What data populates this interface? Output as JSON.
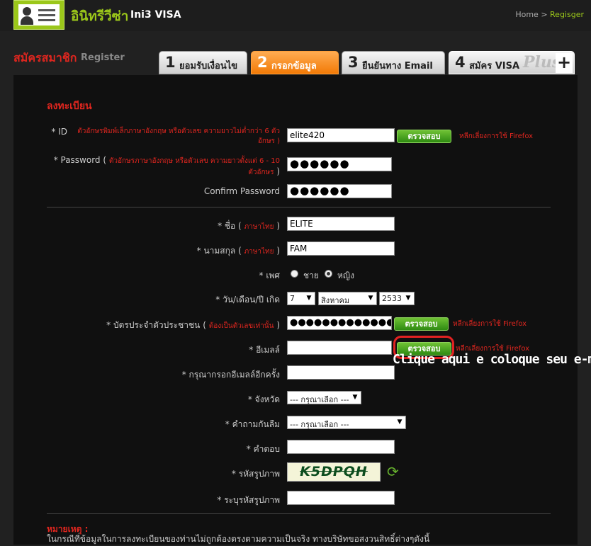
{
  "header": {
    "brand_thai": "อินิทรีวีซ่า",
    "brand_en": "Ini3 VISA",
    "nav_home": "Home",
    "nav_sep": ">",
    "nav_current": "Regisger"
  },
  "page": {
    "title_thai": "สมัครสมาชิก",
    "title_en": "Register"
  },
  "steps": [
    {
      "num": "1",
      "label": "ยอมรับเงื่อนไข",
      "state": "done"
    },
    {
      "num": "2",
      "label": "กรอกข้อมูล",
      "state": "active"
    },
    {
      "num": "3",
      "label": "ยืนยันทาง Email",
      "state": "pending"
    },
    {
      "num": "4",
      "label": "สมัคร VISA",
      "extra": "Plus!",
      "state": "pending"
    }
  ],
  "form": {
    "section_title": "ลงทะเบียน",
    "id": {
      "label": "* ID",
      "hint": "ตัวอักษรพิมพ์เล็กภาษาอังกฤษ หรือตัวเลข ความยาวไม่ต่ำกว่า 6 ตัวอักษร )",
      "value": "elite420",
      "check_label": "ตรวจสอบ",
      "browser_note": "หลีกเลี่ยงการใช้ Firefox"
    },
    "password": {
      "label": "* Password (",
      "hint": "ตัวอักษรภาษาอังกฤษ หรือตัวเลข ความยาวตั้งแต่ 6 - 10 ตัวอักษร",
      "hint_close": ")",
      "value": "●●●●●●"
    },
    "confirm_password": {
      "label": "Confirm Password",
      "value": "●●●●●●"
    },
    "first_name": {
      "label": "* ชื่อ (",
      "note": "ภาษาไทย",
      "close": ")",
      "value": "ELITE"
    },
    "last_name": {
      "label": "* นามสกุล (",
      "note": "ภาษาไทย",
      "close": ")",
      "value": "FAM"
    },
    "gender": {
      "label": "* เพศ",
      "options": [
        "ชาย",
        "หญิง"
      ],
      "selected": "หญิง"
    },
    "birthdate": {
      "label": "* วัน/เดือน/ปี เกิด",
      "day": "7",
      "month": "สิงหาคม",
      "year": "2533"
    },
    "citizen_id": {
      "label": "* บัตรประจำตัวประชาชน (",
      "note": "ต้องเป็นตัวเลขเท่านั้น",
      "close": ")",
      "value": "●●●●●●●●●●●●●",
      "check_label": "ตรวจสอบ",
      "browser_note": "หลีกเลี่ยงการใช้ Firefox"
    },
    "email": {
      "label": "* อีเมลล์",
      "value": "",
      "check_label": "ตรวจสอบ",
      "browser_note": "หลีกเลี่ยงการใช้ Firefox"
    },
    "email_confirm": {
      "label": "* กรุณากรอกอีเมลล์อีกครั้ง",
      "value": ""
    },
    "province": {
      "label": "* จังหวัด",
      "value": "--- กรุณาเลือก ---"
    },
    "security_question": {
      "label": "* คำถามกันลืม",
      "value": "--- กรุณาเลือก ---"
    },
    "answer": {
      "label": "* คำตอบ",
      "value": ""
    },
    "captcha": {
      "label": "* รหัสรูปภาพ",
      "text": "K5DPQH",
      "refresh_icon": "refresh-icon"
    },
    "captcha_input": {
      "label": "* ระบุรหัสรูปภาพ",
      "value": ""
    }
  },
  "notes": {
    "title": "หมายเหตุ :",
    "text": "ในกรณีที่ข้อมูลในการลงทะเบียนของท่านไม่ถูกต้องตรงตามความเป็นจริง ทางบริษัทขอสงวนสิทธิ์ต่างๆดังนี้"
  },
  "annotation": {
    "text": "Clique aqui e coloque seu e-mail"
  },
  "colors": {
    "brand_green": "#9bc71a",
    "accent_red": "#e0261f",
    "active_step": "#f27a06",
    "button_green": "#3a9a1a"
  }
}
